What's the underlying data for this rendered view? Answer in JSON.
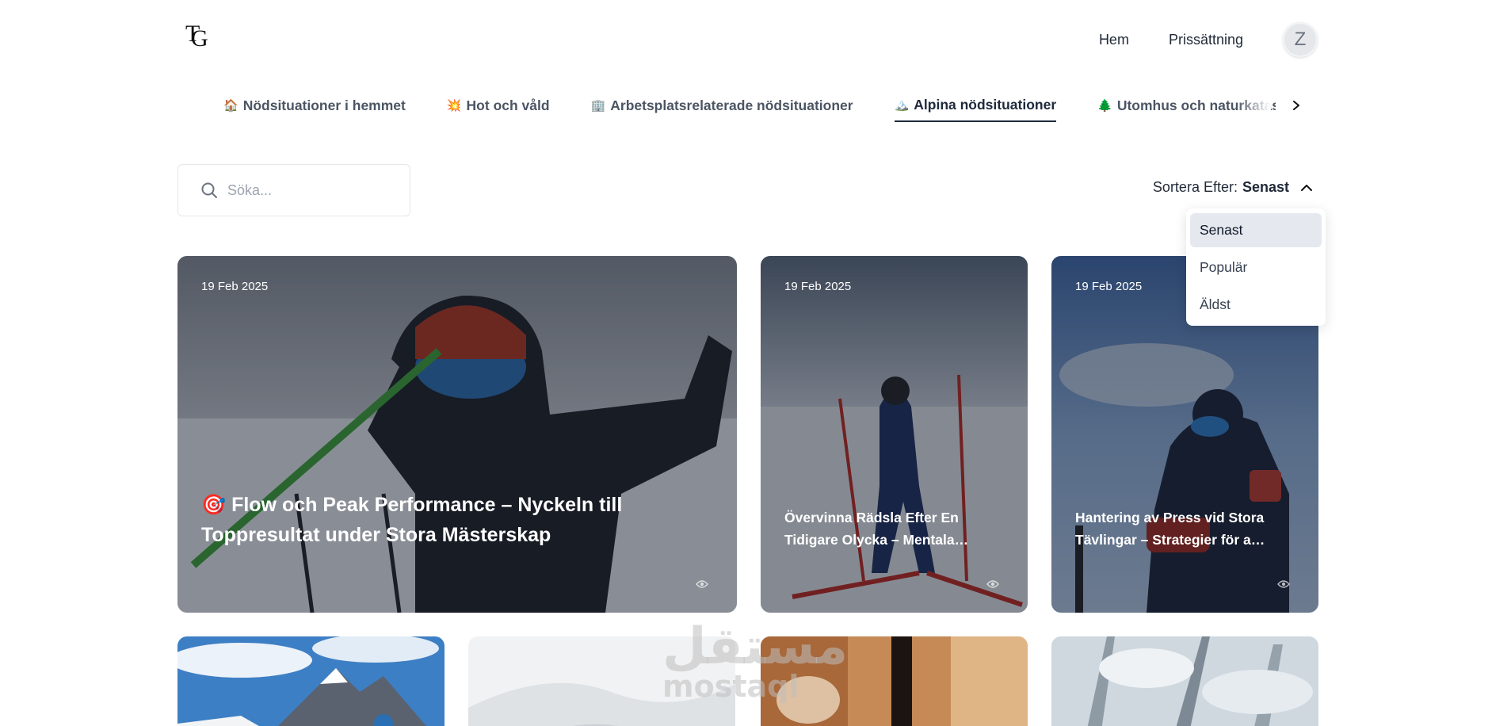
{
  "header": {
    "logo_text": "TG",
    "nav": [
      {
        "label": "Hem"
      },
      {
        "label": "Prissättning"
      }
    ],
    "avatar_initial": "Z"
  },
  "tabs": [
    {
      "emoji": "🏠",
      "label": "Nödsituationer i hemmet",
      "active": false
    },
    {
      "emoji": "💥",
      "label": "Hot och våld",
      "active": false
    },
    {
      "emoji": "🏢",
      "label": "Arbetsplatsrelaterade nödsituationer",
      "active": false
    },
    {
      "emoji": "🏔️",
      "label": "Alpina nödsituationer",
      "active": true
    },
    {
      "emoji": "🌲",
      "label": "Utomhus och naturkatastrofer",
      "active": false
    }
  ],
  "search": {
    "placeholder": "Söka..."
  },
  "sort": {
    "label": "Sortera Efter:",
    "value": "Senast",
    "options": [
      {
        "label": "Senast",
        "selected": true
      },
      {
        "label": "Populär",
        "selected": false
      },
      {
        "label": "Äldst",
        "selected": false
      }
    ]
  },
  "articles": [
    {
      "date": "19 Feb 2025",
      "title": "🎯 Flow och Peak Performance – Nyckeln till Toppresultat under Stora Mästerskap"
    },
    {
      "date": "19 Feb 2025",
      "title": "Övervinna Rädsla Efter En Tidigare Olycka – Mentala strategier för att komma tillbaka"
    },
    {
      "date": "19 Feb 2025",
      "title": "Hantering av Press vid Stora Tävlingar – Strategier för att prestera"
    }
  ],
  "watermark": {
    "arabic": "مستقل",
    "latin": "mostaql"
  },
  "colors": {
    "accent": "#1e293b",
    "tab_text": "#4b5563",
    "dropdown_selected": "#e5e9ef"
  }
}
